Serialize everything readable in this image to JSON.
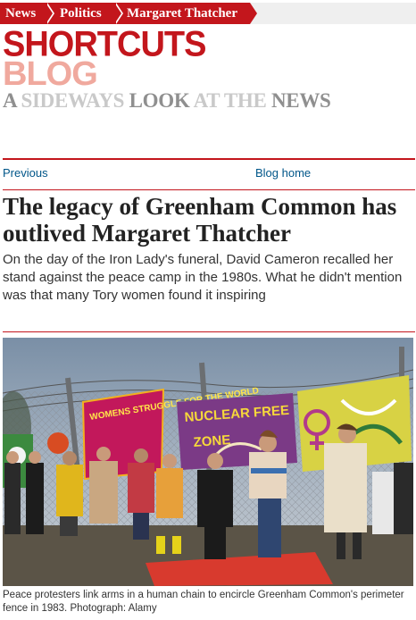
{
  "breadcrumb": {
    "items": [
      {
        "label": "News"
      },
      {
        "label": "Politics"
      },
      {
        "label": "Margaret Thatcher"
      }
    ]
  },
  "masthead": {
    "title": "SHORTCUTS",
    "subtitle": "BLOG",
    "tagline": {
      "a": "A",
      "sideways": "SIDEWAYS",
      "look": "LOOK",
      "at_the": "AT THE",
      "news": "NEWS"
    }
  },
  "nav": {
    "previous_label": "Previous",
    "blog_home_label": "Blog home"
  },
  "article": {
    "headline": "The legacy of Greenham Common has outlived Margaret Thatcher",
    "standfirst": "On the day of the Iron Lady's funeral, David Cameron recalled her stand against the peace camp in the 1980s. What he didn't mention was that many Tory women found it inspiring",
    "photo": {
      "banners": {
        "left": "WOMENS STRUGGLE FOR THE WORLD",
        "centre_a": "NUCLEAR FREE",
        "centre_b": "ZONE"
      },
      "caption": "Peace protesters link arms in a human chain to encircle Greenham Common's perimeter fence in 1983. Photograph: Alamy"
    }
  },
  "colors": {
    "brand_red": "#c3161c",
    "link_blue": "#005689",
    "blog_pink": "#f0a99e",
    "tagline_light": "#c9c9c9",
    "tagline_dark": "#8f8f8f"
  }
}
